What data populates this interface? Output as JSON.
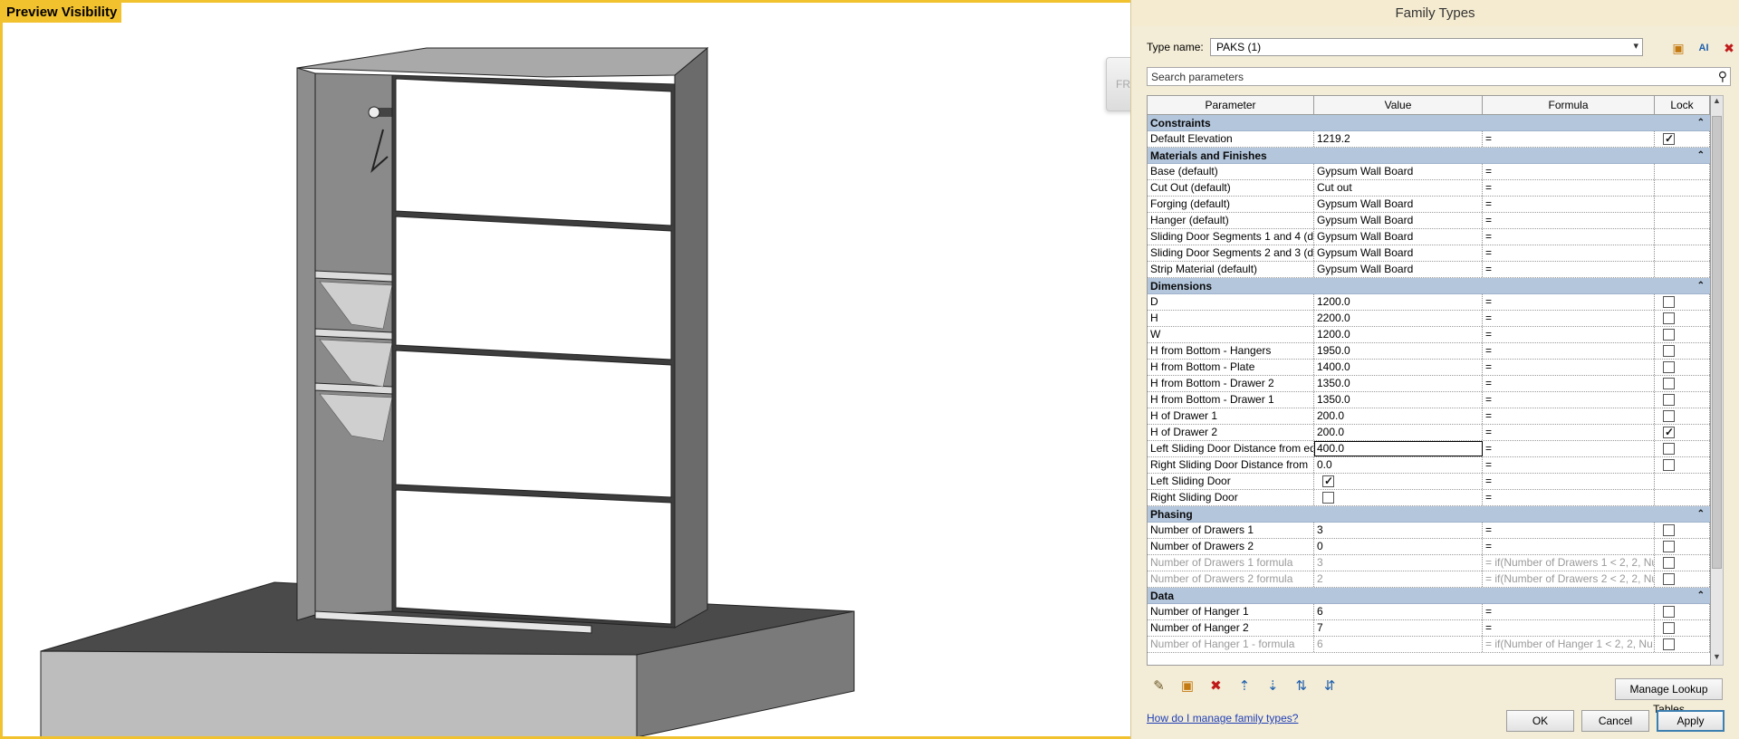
{
  "preview": {
    "label": "Preview Visibility",
    "viewcube_label": "FRO"
  },
  "dialog": {
    "title": "Family Types",
    "type_name_label": "Type name:",
    "type_name_value": "PAKS (1)",
    "search_placeholder": "Search parameters",
    "columns": [
      "Parameter",
      "Value",
      "Formula",
      "Lock"
    ],
    "groups": [
      {
        "name": "Constraints",
        "rows": [
          {
            "param": "Default Elevation",
            "value": "1219.2",
            "formula": "=",
            "lock": true
          }
        ]
      },
      {
        "name": "Materials and Finishes",
        "rows": [
          {
            "param": "Base (default)",
            "value": "Gypsum Wall Board",
            "formula": "="
          },
          {
            "param": "Cut Out (default)",
            "value": "Cut out",
            "formula": "="
          },
          {
            "param": "Forging (default)",
            "value": "Gypsum Wall Board",
            "formula": "="
          },
          {
            "param": "Hanger (default)",
            "value": "Gypsum Wall Board",
            "formula": "="
          },
          {
            "param": "Sliding Door Segments 1 and 4 (de",
            "value": "Gypsum Wall Board",
            "formula": "="
          },
          {
            "param": "Sliding Door Segments 2 and 3 (de",
            "value": "Gypsum Wall Board",
            "formula": "="
          },
          {
            "param": "Strip Material (default)",
            "value": "Gypsum Wall Board",
            "formula": "="
          }
        ]
      },
      {
        "name": "Dimensions",
        "rows": [
          {
            "param": "D",
            "value": "1200.0",
            "formula": "=",
            "lock": false
          },
          {
            "param": "H",
            "value": "2200.0",
            "formula": "=",
            "lock": false
          },
          {
            "param": "W",
            "value": "1200.0",
            "formula": "=",
            "lock": false
          },
          {
            "param": "H from Bottom - Hangers",
            "value": "1950.0",
            "formula": "=",
            "lock": false
          },
          {
            "param": "H from Bottom - Plate",
            "value": "1400.0",
            "formula": "=",
            "lock": false
          },
          {
            "param": "H from Bottom - Drawer 2",
            "value": "1350.0",
            "formula": "=",
            "lock": false
          },
          {
            "param": "H from Bottom - Drawer 1",
            "value": "1350.0",
            "formula": "=",
            "lock": false
          },
          {
            "param": "H of Drawer 1",
            "value": "200.0",
            "formula": "=",
            "lock": false
          },
          {
            "param": "H of Drawer 2",
            "value": "200.0",
            "formula": "=",
            "lock": true
          },
          {
            "param": "Left Sliding Door Distance from ed",
            "value": "400.0",
            "formula": "=",
            "lock": false,
            "editing": true
          },
          {
            "param": "Right Sliding Door Distance from",
            "value": "0.0",
            "formula": "=",
            "lock": false
          },
          {
            "param": "Left Sliding Door",
            "value_checkbox": true,
            "formula": "="
          },
          {
            "param": "Right Sliding Door",
            "value_checkbox": false,
            "formula": "="
          }
        ]
      },
      {
        "name": "Phasing",
        "rows": [
          {
            "param": "Number of Drawers 1",
            "value": "3",
            "formula": "=",
            "lock": false
          },
          {
            "param": "Number of Drawers 2",
            "value": "0",
            "formula": "=",
            "lock": false
          },
          {
            "param": "Number of Drawers 1 formula",
            "value": "3",
            "formula": "= if(Number of Drawers 1 < 2, 2, Nu",
            "lock": false,
            "dim": true
          },
          {
            "param": "Number of Drawers 2 formula",
            "value": "2",
            "formula": "= if(Number of Drawers 2 < 2, 2, Nu",
            "lock": false,
            "dim": true
          }
        ]
      },
      {
        "name": "Data",
        "rows": [
          {
            "param": "Number of Hanger 1",
            "value": "6",
            "formula": "=",
            "lock": false
          },
          {
            "param": "Number of Hanger 2",
            "value": "7",
            "formula": "=",
            "lock": false
          },
          {
            "param": "Number of Hanger 1 - formula",
            "value": "6",
            "formula": "= if(Number of Hanger 1 < 2, 2, Nu",
            "lock": false,
            "dim": true
          }
        ]
      }
    ],
    "manage_lookup_label": "Manage Lookup Tables",
    "help_link": "How do I manage family types?",
    "ok_label": "OK",
    "cancel_label": "Cancel",
    "apply_label": "Apply"
  }
}
